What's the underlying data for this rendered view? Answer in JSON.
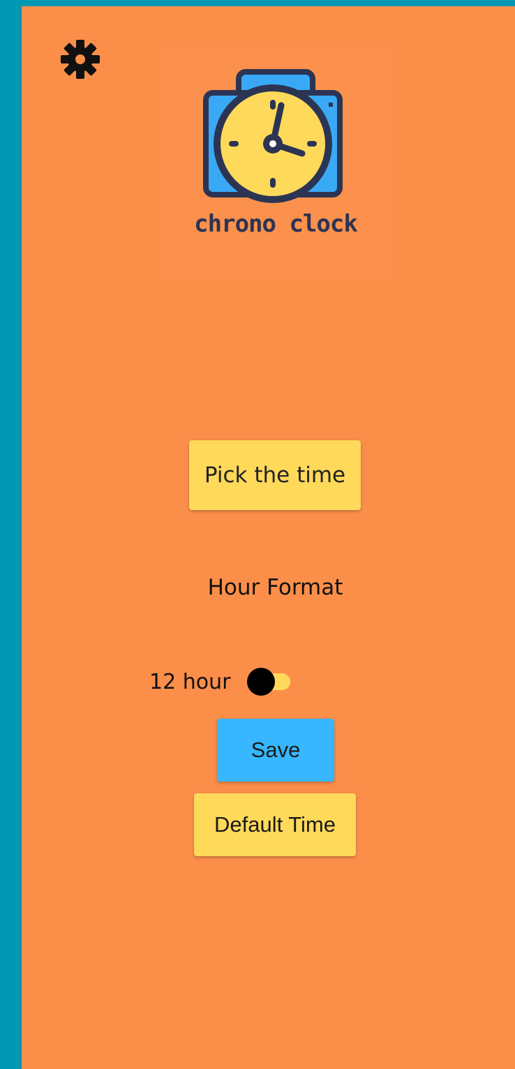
{
  "app": {
    "logo_text": "chrono clock"
  },
  "icons": {
    "settings": "gear-icon",
    "logo": "alarm-clock-icon"
  },
  "main": {
    "pick_time_label": "Pick the time",
    "hour_format_label": "Hour Format",
    "toggle": {
      "label": "12 hour",
      "state": "off"
    },
    "save_label": "Save",
    "default_time_label": "Default Time"
  },
  "colors": {
    "frame": "#0097b2",
    "background": "#fb8f4a",
    "yellow_button": "#ffd95a",
    "blue_button": "#38b6ff",
    "toggle_thumb": "#000000"
  }
}
